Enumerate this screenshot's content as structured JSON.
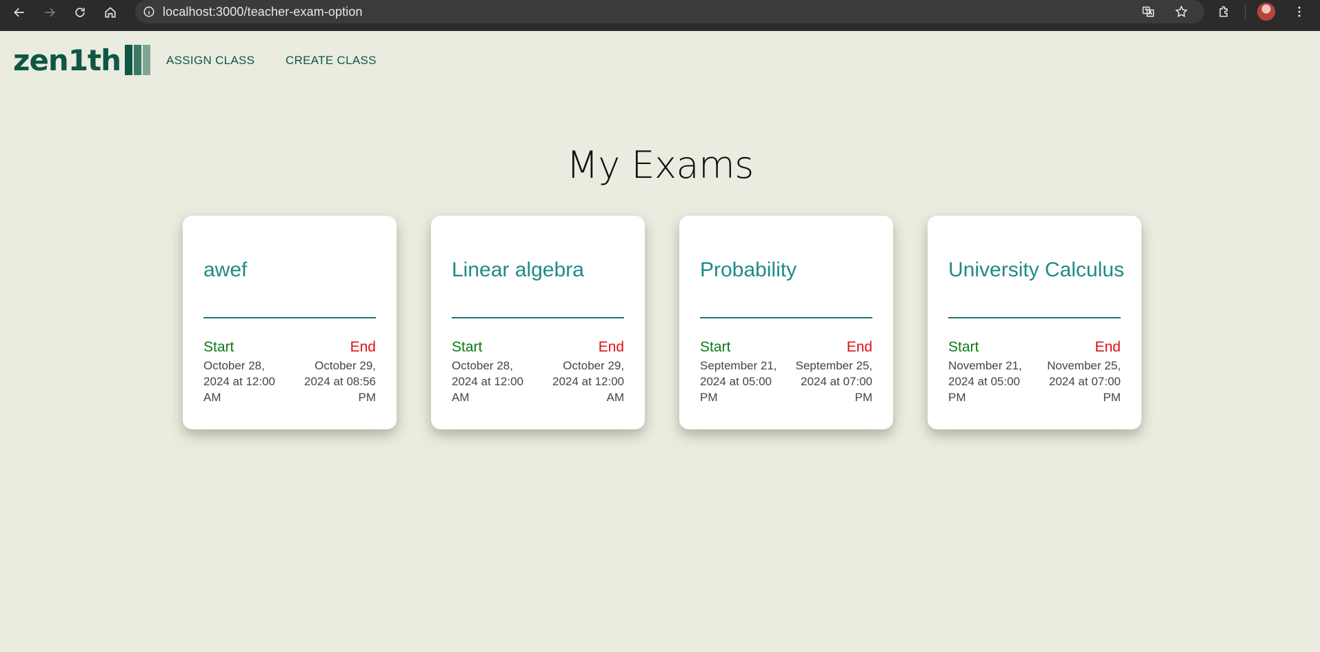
{
  "browser": {
    "url": "localhost:3000/teacher-exam-option"
  },
  "header": {
    "logo_text": "zen1th",
    "logo_bar_colors": [
      "#0f5646",
      "#3c7a68",
      "#7fa593"
    ],
    "nav": [
      {
        "label": "ASSIGN CLASS"
      },
      {
        "label": "CREATE CLASS"
      }
    ]
  },
  "main": {
    "title": "My Exams",
    "start_label": "Start",
    "end_label": "End",
    "exams": [
      {
        "name": "awef",
        "start": "October 28, 2024 at 12:00 AM",
        "end": "October 29, 2024 at 08:56 PM"
      },
      {
        "name": "Linear algebra",
        "start": "October 28, 2024 at 12:00 AM",
        "end": "October 29, 2024 at 12:00 AM"
      },
      {
        "name": "Probability",
        "start": "September 21, 2024 at 05:00 PM",
        "end": "September 25, 2024 at 07:00 PM"
      },
      {
        "name": "University Calculus",
        "start": "November 21, 2024 at 05:00 PM",
        "end": "November 25, 2024 at 07:00 PM"
      }
    ]
  },
  "colors": {
    "background": "#e9ecdf",
    "brand": "#0f5646",
    "card_title": "#1f8a8a",
    "start": "#0d7a12",
    "end": "#e01010"
  }
}
